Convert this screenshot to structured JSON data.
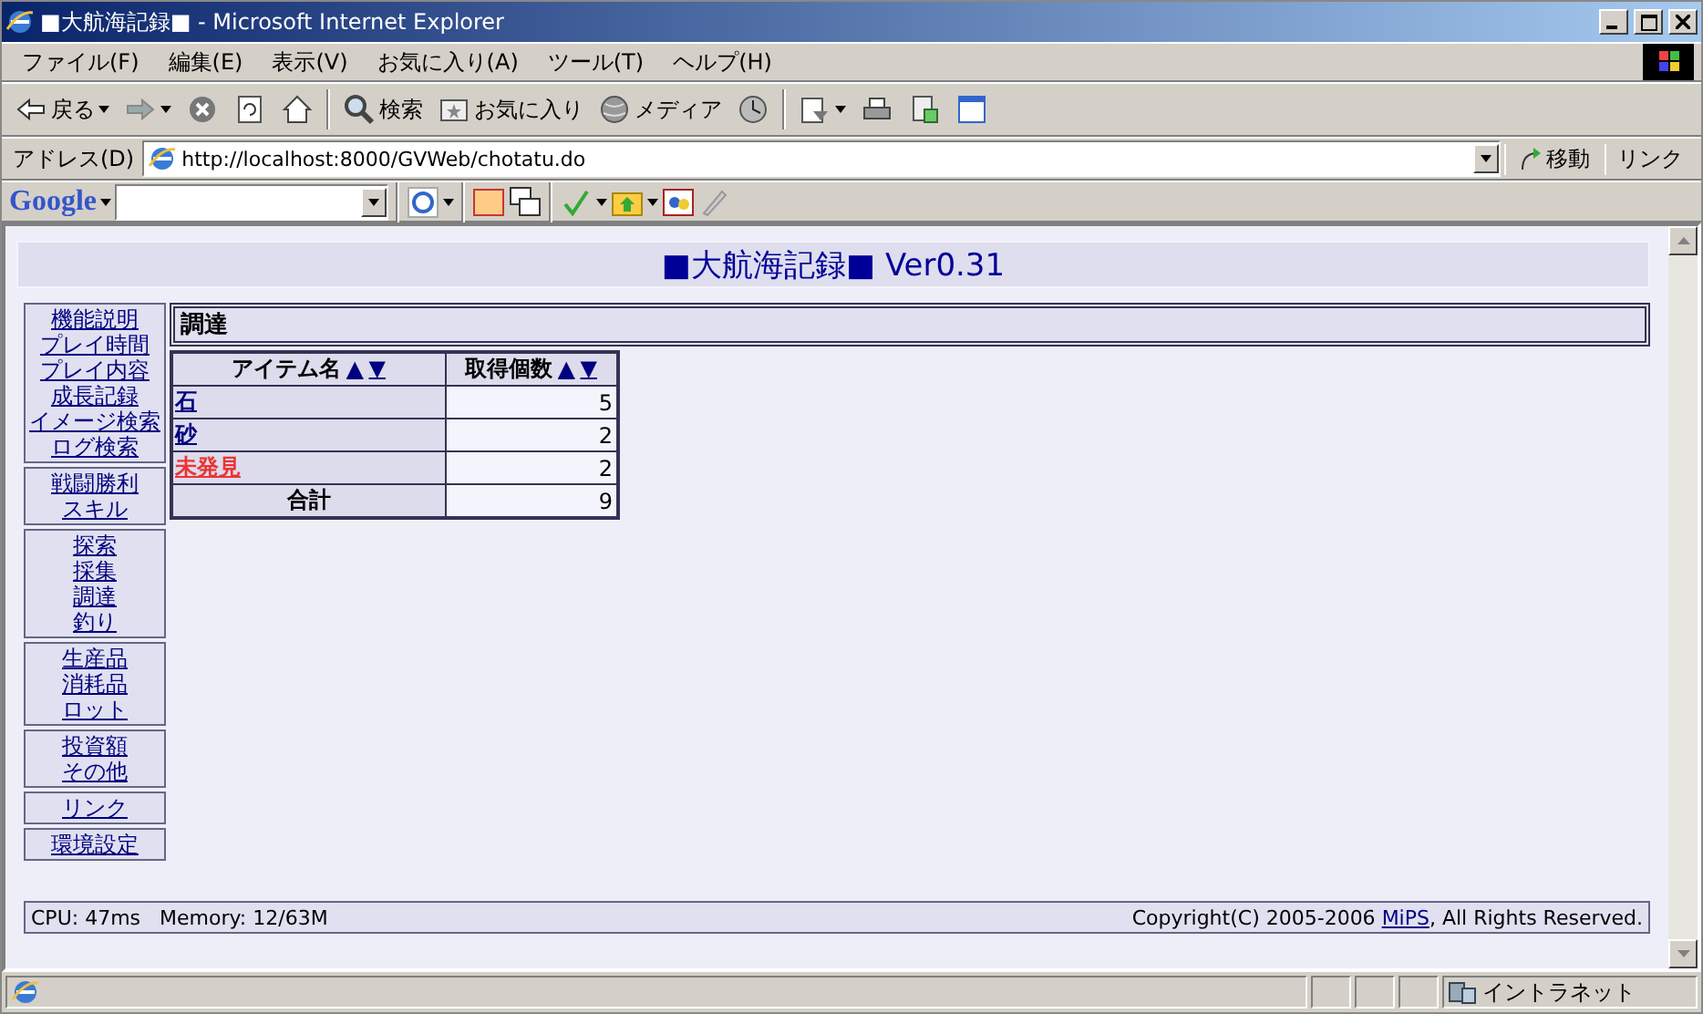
{
  "window": {
    "title": "■大航海記録■ - Microsoft Internet Explorer"
  },
  "menu": [
    {
      "label": "ファイル(F)"
    },
    {
      "label": "編集(E)"
    },
    {
      "label": "表示(V)"
    },
    {
      "label": "お気に入り(A)"
    },
    {
      "label": "ツール(T)"
    },
    {
      "label": "ヘルプ(H)"
    }
  ],
  "toolbar": [
    {
      "kind": "back",
      "label": "戻る",
      "dropdown": true
    },
    {
      "kind": "forward",
      "dropdown": true
    },
    {
      "kind": "stop"
    },
    {
      "kind": "refresh"
    },
    {
      "kind": "home"
    },
    {
      "kind": "sep"
    },
    {
      "kind": "search",
      "label": "検索"
    },
    {
      "kind": "favorites",
      "label": "お気に入り"
    },
    {
      "kind": "media",
      "label": "メディア"
    },
    {
      "kind": "history"
    },
    {
      "kind": "sep"
    },
    {
      "kind": "mail",
      "dropdown": true
    },
    {
      "kind": "print"
    },
    {
      "kind": "edit"
    },
    {
      "kind": "window"
    }
  ],
  "address": {
    "label": "アドレス(D)",
    "value": "http://localhost:8000/GVWeb/chotatu.do",
    "go": "移動",
    "links": "リンク"
  },
  "google": {
    "logo": "Google"
  },
  "page": {
    "title": "■大航海記録■ Ver0.31",
    "nav": [
      [
        {
          "label": "機能説明"
        },
        {
          "label": "プレイ時間"
        },
        {
          "label": "プレイ内容"
        },
        {
          "label": "成長記録"
        },
        {
          "label": "イメージ検索"
        },
        {
          "label": "ログ検索"
        }
      ],
      [
        {
          "label": "戦闘勝利"
        },
        {
          "label": "スキル"
        }
      ],
      [
        {
          "label": "探索"
        },
        {
          "label": "採集"
        },
        {
          "label": "調達"
        },
        {
          "label": "釣り"
        }
      ],
      [
        {
          "label": "生産品"
        },
        {
          "label": "消耗品"
        },
        {
          "label": "ロット"
        }
      ],
      [
        {
          "label": "投資額"
        },
        {
          "label": "その他"
        }
      ],
      [
        {
          "label": "リンク"
        }
      ],
      [
        {
          "label": "環境設定"
        }
      ]
    ],
    "section": "調達",
    "columns": [
      {
        "label": "アイテム名",
        "up": "▲",
        "down": "▼"
      },
      {
        "label": "取得個数",
        "up": "▲",
        "down": "▼"
      }
    ],
    "rows": [
      {
        "name": "石",
        "count": "5",
        "found": true
      },
      {
        "name": "砂",
        "count": "2",
        "found": true
      },
      {
        "name": "未発見",
        "count": "2",
        "found": false
      }
    ],
    "total": {
      "label": "合計",
      "value": "9"
    },
    "footer": {
      "stats": "CPU: 47ms   Memory: 12/63M",
      "before": "Copyright(C) 2005-2006 ",
      "link": "MiPS",
      "after": ", All Rights Reserved."
    }
  },
  "status": {
    "zone": "イントラネット"
  }
}
